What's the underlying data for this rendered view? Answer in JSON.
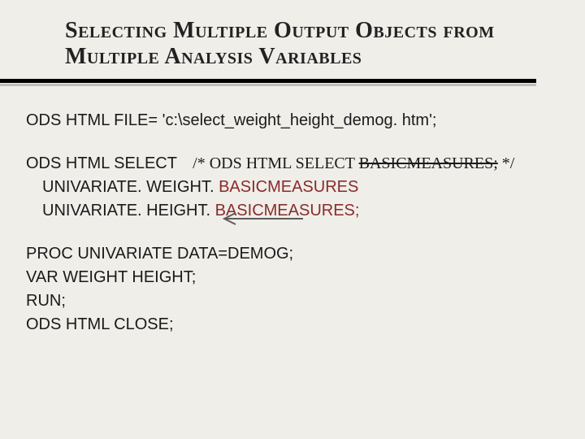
{
  "title": "Selecting Multiple Output Objects from Multiple Analysis Variables",
  "code": {
    "line1": "ODS HTML FILE= 'c:\\select_weight_height_demog. htm';",
    "select_label": "ODS HTML SELECT",
    "comment_prefix": "/* ODS HTML SELECT ",
    "comment_strike": "BASICMEASURES;",
    "comment_suffix": " */",
    "univariate_weight_prefix": "UNIVARIATE. WEIGHT. ",
    "univariate_weight_red": "BASICMEASURES",
    "univariate_height_prefix": "UNIVARIATE. HEIGHT. ",
    "univariate_height_red": "BASICMEASURES;",
    "proc": "PROC UNIVARIATE DATA=DEMOG;",
    "var": " VAR WEIGHT HEIGHT;",
    "run": "RUN;",
    "close": "ODS HTML CLOSE;"
  }
}
